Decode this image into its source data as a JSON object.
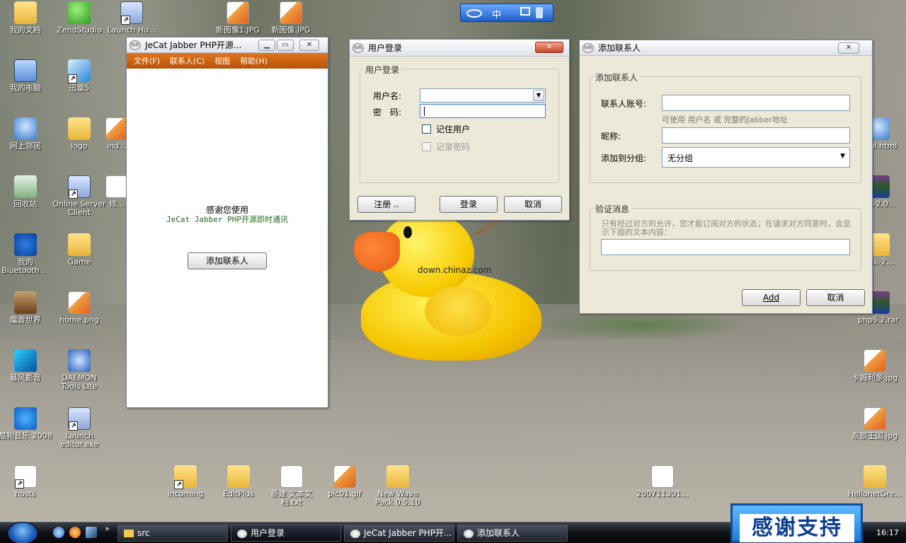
{
  "desktop": {
    "icons_left": [
      {
        "label": "我的文档",
        "kind": "folder"
      },
      {
        "label": "我的电脑",
        "kind": "pc"
      },
      {
        "label": "网上邻居",
        "kind": "net"
      },
      {
        "label": "回收站",
        "kind": "bin"
      },
      {
        "label": "我的 Bluetooth ...",
        "kind": "bt"
      },
      {
        "label": "魔兽世界",
        "kind": "game"
      },
      {
        "label": "暴风影音",
        "kind": "storm"
      },
      {
        "label": "酷狗音乐 2008",
        "kind": "kugou"
      },
      {
        "label": "hosts",
        "kind": "doc"
      }
    ],
    "icons_col2": [
      {
        "label": "ZendStudio",
        "kind": "zend"
      },
      {
        "label": "迅雷5",
        "kind": "bird"
      },
      {
        "label": "logo",
        "kind": "folder"
      },
      {
        "label": "Online Server Client",
        "kind": "app"
      },
      {
        "label": "Game",
        "kind": "folder"
      },
      {
        "label": "home.png",
        "kind": "img"
      },
      {
        "label": "DAEMON Tools Lite",
        "kind": "daemon"
      },
      {
        "label": "Launch editor.exe",
        "kind": "app"
      }
    ],
    "icons_top": [
      {
        "label": "Launch Ho...",
        "kind": "app"
      },
      {
        "label": "新图像1.JPG",
        "kind": "img"
      },
      {
        "label": "新图像.JPG",
        "kind": "img"
      }
    ],
    "icons_col3": [
      {
        "label": "ind...",
        "kind": "img"
      },
      {
        "label": "修..."
      }
    ],
    "icons_bottom": [
      {
        "label": "incoming",
        "kind": "folder"
      },
      {
        "label": "EditPlus",
        "kind": "folder"
      },
      {
        "label": "新建 文本文档.txt",
        "kind": "doc"
      },
      {
        "label": "pic01.gif",
        "kind": "img"
      },
      {
        "label": "New Wave Pack 0.5.10",
        "kind": "folder"
      },
      {
        "label": "200711301...",
        "kind": "doc"
      }
    ],
    "icons_right": [
      {
        "label": "...ml.html",
        "kind": "net"
      },
      {
        "label": "...k-2.0...",
        "kind": "rar"
      },
      {
        "label": "...tk-2...",
        "kind": "folder"
      },
      {
        "label": "php5.2.rar",
        "kind": "rar"
      },
      {
        "label": "卡姆利多.jpg",
        "kind": "img"
      },
      {
        "label": "东部王国.jpg",
        "kind": "img"
      },
      {
        "label": "HellonetGre...",
        "kind": "folder"
      }
    ],
    "watermark": "down.chinaz.com",
    "langbar_label": "中",
    "banner_text": "感谢支持"
  },
  "jecat": {
    "title": "JeCat Jabber PHP开源...",
    "menu": [
      "文件(F)",
      "联系人(C)",
      "视图",
      "帮助(H)"
    ],
    "welcome": "感谢您使用",
    "product": "JeCat Jabber PHP开源即时通讯",
    "add_contact_btn": "添加联系人"
  },
  "login": {
    "title": "用户登录",
    "group_label": "用户登录",
    "username_label": "用户名:",
    "password_label": "密　码:",
    "username_value": "",
    "password_value": "",
    "remember_user": "记住用户",
    "remember_password": "记录密码",
    "register_btn": "注册 ..",
    "login_btn": "登录",
    "cancel_btn": "取消"
  },
  "add_contact": {
    "title": "添加联系人",
    "group_label": "添加联系人",
    "account_label": "联系人账号:",
    "account_hint": "可使用 用户名 或 完整的Jabber地址",
    "nickname_label": "昵称:",
    "group_select_label": "添加到分组:",
    "group_select_value": "无分组",
    "verify_group_label": "验证消息",
    "verify_text": "只有经过对方的允许，您才能订阅对方的状态；在请求对方同意时，会显示下面的文本内容：",
    "add_btn": "Add",
    "cancel_btn": "取消"
  },
  "taskbar": {
    "tasks": [
      {
        "label": "src",
        "icon": "folder"
      },
      {
        "label": "用户登录",
        "icon": "app"
      },
      {
        "label": "JeCat Jabber PHP开...",
        "icon": "app"
      },
      {
        "label": "添加联系人",
        "icon": "app"
      }
    ],
    "time": "16:17"
  }
}
